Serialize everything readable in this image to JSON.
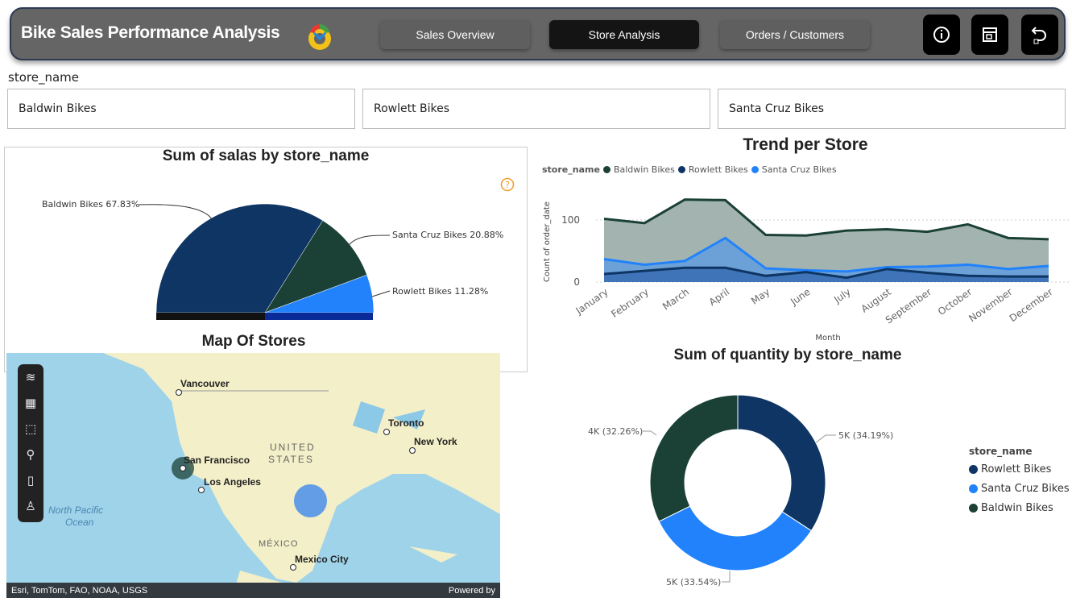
{
  "header": {
    "title": "Bike Sales Performance Analysis",
    "tabs": [
      {
        "label": "Sales Overview",
        "active": false
      },
      {
        "label": "Store Analysis",
        "active": true
      },
      {
        "label": "Orders / Customers",
        "active": false
      }
    ],
    "icons": [
      "info-icon",
      "report-icon",
      "back-arrow-icon"
    ]
  },
  "slicer": {
    "label": "store_name",
    "options": [
      "Baldwin Bikes",
      "Rowlett Bikes",
      "Santa Cruz Bikes"
    ]
  },
  "colors": {
    "baldwin": "#1b4136",
    "rowlett": "#0e3563",
    "santa_cruz": "#2182fb"
  },
  "chart_data": [
    {
      "type": "pie",
      "title": "Sum of salas by store_name",
      "variant": "half-pie",
      "slices": [
        {
          "name": "Baldwin Bikes",
          "value": 67.83,
          "label": "Baldwin Bikes 67.83%"
        },
        {
          "name": "Santa Cruz Bikes",
          "value": 20.88,
          "label": "Santa Cruz Bikes 20.88%"
        },
        {
          "name": "Rowlett Bikes",
          "value": 11.28,
          "label": "Rowlett Bikes 11.28%"
        }
      ]
    },
    {
      "type": "area",
      "title": "Trend per Store",
      "legend_title": "store_name",
      "legend_position": "top-left",
      "xlabel": "Month",
      "ylabel": "Count of order_date",
      "ylim": [
        0,
        140
      ],
      "yticks": [
        0,
        100
      ],
      "categories": [
        "January",
        "February",
        "March",
        "April",
        "May",
        "June",
        "July",
        "August",
        "September",
        "October",
        "November",
        "December"
      ],
      "series": [
        {
          "name": "Baldwin Bikes",
          "values": [
            102,
            95,
            133,
            132,
            76,
            75,
            83,
            85,
            81,
            93,
            71,
            69
          ]
        },
        {
          "name": "Rowlett Bikes",
          "values": [
            13,
            18,
            23,
            23,
            10,
            16,
            7,
            21,
            15,
            10,
            9,
            9
          ]
        },
        {
          "name": "Santa Cruz Bikes",
          "values": [
            37,
            28,
            34,
            71,
            22,
            19,
            17,
            24,
            25,
            28,
            21,
            26
          ]
        }
      ]
    },
    {
      "type": "pie",
      "variant": "donut",
      "title": "Sum of quantity by store_name",
      "legend_title": "store_name",
      "legend_position": "right",
      "slices": [
        {
          "name": "Rowlett Bikes",
          "value": 34.19,
          "label": "5K (34.19%)"
        },
        {
          "name": "Santa Cruz Bikes",
          "value": 33.54,
          "label": "5K (33.54%)"
        },
        {
          "name": "Baldwin Bikes",
          "value": 32.26,
          "label": "4K (32.26%)"
        }
      ]
    }
  ],
  "map": {
    "title": "Map Of Stores",
    "cities": [
      "Vancouver",
      "Toronto",
      "New York",
      "San Francisco",
      "Los Angeles",
      "Mexico City"
    ],
    "regions": [
      "UNITED",
      "STATES",
      "MÉXICO"
    ],
    "ocean": [
      "North Pacific",
      "Ocean"
    ],
    "attribution": "Esri, TomTom, FAO, NOAA, USGS",
    "powered_by": "Powered by",
    "tools": [
      "layers-icon",
      "legend-icon",
      "select-icon",
      "search-icon",
      "bar-chart-icon",
      "person-icon"
    ]
  }
}
